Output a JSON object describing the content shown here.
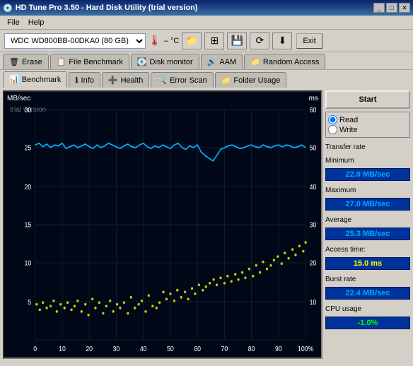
{
  "titleBar": {
    "title": "HD Tune Pro 3.50 - Hard Disk Utility (trial version)",
    "icon": "💿",
    "controls": [
      "_",
      "□",
      "✕"
    ]
  },
  "menuBar": {
    "items": [
      "File",
      "Help"
    ]
  },
  "toolbar": {
    "diskSelect": {
      "value": "WDC   WD800BB-00DKA0 (80 GB)",
      "options": [
        "WDC   WD800BB-00DKA0 (80 GB)"
      ]
    },
    "tempLabel": "– °C",
    "buttons": [
      "folder-icon",
      "grid-icon",
      "save-icon",
      "refresh-icon",
      "download-icon"
    ],
    "exitLabel": "Exit"
  },
  "tabs1": [
    {
      "label": "Erase",
      "icon": "🗑"
    },
    {
      "label": "File Benchmark",
      "icon": "📋"
    },
    {
      "label": "Disk monitor",
      "icon": "💽"
    },
    {
      "label": "AAM",
      "icon": "🔊"
    },
    {
      "label": "Random Access",
      "icon": "📁"
    }
  ],
  "tabs2": [
    {
      "label": "Benchmark",
      "icon": "📊",
      "active": true
    },
    {
      "label": "Info",
      "icon": "ℹ"
    },
    {
      "label": "Health",
      "icon": "➕"
    },
    {
      "label": "Error Scan",
      "icon": "🔍"
    },
    {
      "label": "Folder Usage",
      "icon": "📁"
    }
  ],
  "rightPanel": {
    "startLabel": "Start",
    "radioGroup": {
      "options": [
        "Read",
        "Write"
      ],
      "selected": "Read"
    },
    "stats": {
      "transferRateLabel": "Transfer rate",
      "minimumLabel": "Minimum",
      "minimumValue": "22.9 MB/sec",
      "maximumLabel": "Maximum",
      "maximumValue": "27.0 MB/sec",
      "averageLabel": "Average",
      "averageValue": "25.3 MB/sec",
      "accessTimeLabel": "Access time:",
      "accessTimeValue": "15.0 ms",
      "burstRateLabel": "Burst rate",
      "burstRateValue": "22.4 MB/sec",
      "cpuUsageLabel": "CPU usage",
      "cpuUsageValue": "-1.0%"
    }
  },
  "chart": {
    "yLeftLabel": "MB/sec",
    "yRightLabel": "ms",
    "xRightLabel": "100%",
    "watermark": "trial version",
    "yLeftMax": 30,
    "yRightMax": 60,
    "gridLines": [
      0,
      5,
      10,
      15,
      20,
      25,
      30
    ]
  }
}
